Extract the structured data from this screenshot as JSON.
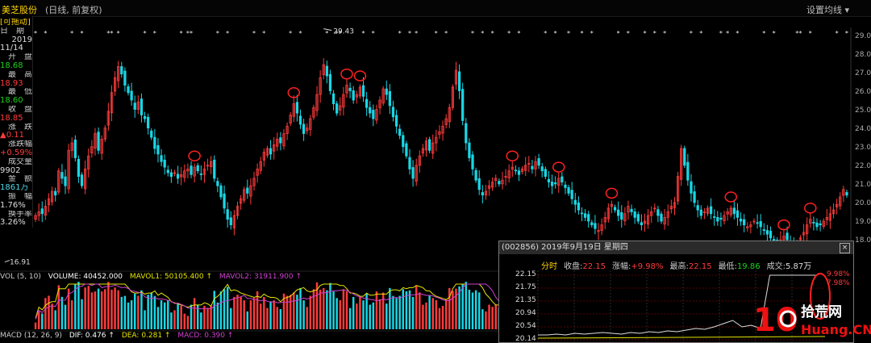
{
  "header": {
    "stock_name": "美芝股份",
    "mode": "(日线, 前复权)",
    "settings_label": "设置均线 ▾"
  },
  "info_panel": {
    "items": [
      {
        "text": "[可拖动]",
        "color": "#ffd400"
      },
      {
        "text": "日　期",
        "color": "#ccc"
      },
      {
        "text": "2019",
        "color": "#ddd"
      },
      {
        "text": "11/14",
        "color": "#ddd"
      },
      {
        "text": "开　盘",
        "color": "#ccc"
      },
      {
        "text": "18.68",
        "color": "#19d319"
      },
      {
        "text": "最　高",
        "color": "#ccc"
      },
      {
        "text": "18.93",
        "color": "#ff3b3b"
      },
      {
        "text": "最　低",
        "color": "#ccc"
      },
      {
        "text": "18.60",
        "color": "#19d319"
      },
      {
        "text": "收　盘",
        "color": "#ccc"
      },
      {
        "text": "18.85",
        "color": "#ff3b3b"
      },
      {
        "text": "涨　跌",
        "color": "#ccc"
      },
      {
        "text": "▲0.11",
        "color": "#ff3b3b"
      },
      {
        "text": "涨跌幅",
        "color": "#ccc"
      },
      {
        "text": "+0.59%",
        "color": "#ff3b3b"
      },
      {
        "text": "成交量",
        "color": "#ccc"
      },
      {
        "text": "9902",
        "color": "#ddd"
      },
      {
        "text": "金　额",
        "color": "#ccc"
      },
      {
        "text": "1861万",
        "color": "#4fd7e6"
      },
      {
        "text": "振　幅",
        "color": "#ccc"
      },
      {
        "text": "1.76%",
        "color": "#ddd"
      },
      {
        "text": "换手率",
        "color": "#ccc"
      },
      {
        "text": "3.26%",
        "color": "#ddd"
      }
    ]
  },
  "price_axis": {
    "ticks": [
      "29.00",
      "28.00",
      "27.00",
      "26.00",
      "25.00",
      "24.00",
      "23.00",
      "22.00",
      "21.00",
      "20.00",
      "19.00",
      "18.00"
    ]
  },
  "annotations": {
    "high_label": "29.43",
    "low_label": "16.91"
  },
  "volume_legend": {
    "name": "VOL (5, 10)",
    "volume": "VOLUME: 40452.000",
    "mavol1": "MAVOL1: 50105.400 ↑",
    "mavol2": "MAVOL2: 31911.900 ↑"
  },
  "macd_legend": {
    "name": "MACD (12, 26, 9)",
    "dif": "DIF: 0.476 ↑",
    "dea": "DEA: 0.281 ↑",
    "macd": "MACD: 0.390 ↑"
  },
  "popup": {
    "title": "(002856) 2019年9月19日 星期四",
    "close_label": "×",
    "info": [
      {
        "label": "分时",
        "value": ""
      },
      {
        "label": "收盘:",
        "value": "22.15"
      },
      {
        "label": "涨幅:",
        "value": "+9.98%"
      },
      {
        "label": "最高:",
        "value": "22.15"
      },
      {
        "label": "最低:",
        "value": "19.86"
      },
      {
        "label": "成交:",
        "value": "5.87万"
      }
    ],
    "left_ticks": [
      "22.15",
      "21.75",
      "21.35",
      "20.94",
      "20.54",
      "20.14"
    ],
    "right_ticks": [
      "9.98%",
      "7.98%"
    ]
  },
  "watermark": {
    "logo_number": "10",
    "text_top": "拾荒网",
    "text_bottom": "Huang.CN"
  },
  "colors": {
    "up": "#ff3b3b",
    "down": "#19d7e6",
    "ma_yellow": "#e5e500",
    "ma_magenta": "#d040d0",
    "accent": "#ffd400"
  },
  "chart_data": {
    "type": "candlestick",
    "ylim": [
      16.5,
      29.5
    ],
    "key_prices": {
      "high": 29.43,
      "low": 16.91
    },
    "closes": [
      19.4,
      19.6,
      19.5,
      19.9,
      20.3,
      20.7,
      20.5,
      21.8,
      21.4,
      21.0,
      22.9,
      23.3,
      22.5,
      21.5,
      21.0,
      21.9,
      22.6,
      23.1,
      23.8,
      22.9,
      23.5,
      24.1,
      25.0,
      26.0,
      26.8,
      27.4,
      27.0,
      26.4,
      26.0,
      25.6,
      25.1,
      25.5,
      24.8,
      24.6,
      24.1,
      23.6,
      23.0,
      22.7,
      22.3,
      22.0,
      21.7,
      21.5,
      21.7,
      21.4,
      21.6,
      21.8,
      21.9,
      21.6,
      22.0,
      21.8,
      21.6,
      21.9,
      22.1,
      22.3,
      21.4,
      21.0,
      20.4,
      19.8,
      19.2,
      18.9,
      19.4,
      19.9,
      20.3,
      20.8,
      20.6,
      21.0,
      21.4,
      21.9,
      22.3,
      22.8,
      23.0,
      22.7,
      23.2,
      23.5,
      23.3,
      23.8,
      24.2,
      24.8,
      25.4,
      24.9,
      24.3,
      23.8,
      24.1,
      24.6,
      25.2,
      25.9,
      26.8,
      27.5,
      26.9,
      26.1,
      25.4,
      24.9,
      25.3,
      25.9,
      26.4,
      26.1,
      25.6,
      25.9,
      26.3,
      25.8,
      25.2,
      24.9,
      24.6,
      25.1,
      25.6,
      26.2,
      25.9,
      25.3,
      24.7,
      24.2,
      23.7,
      23.1,
      22.6,
      21.9,
      21.4,
      22.1,
      22.6,
      23.0,
      23.4,
      22.9,
      23.3,
      23.6,
      23.9,
      24.2,
      24.6,
      25.2,
      26.3,
      27.2,
      26.1,
      24.5,
      23.3,
      22.5,
      21.9,
      21.3,
      20.8,
      20.5,
      20.7,
      21.0,
      21.2,
      21.4,
      21.1,
      21.3,
      21.5,
      21.8,
      22.0,
      21.8,
      21.6,
      21.9,
      22.1,
      22.2,
      21.9,
      22.3,
      22.1,
      21.8,
      21.5,
      21.2,
      21.0,
      21.1,
      21.4,
      21.2,
      20.9,
      20.6,
      20.3,
      20.0,
      19.7,
      19.5,
      19.3,
      19.1,
      18.9,
      18.7,
      18.6,
      18.9,
      19.3,
      19.8,
      20.0,
      19.7,
      19.4,
      19.2,
      19.5,
      19.9,
      19.6,
      19.3,
      19.1,
      18.9,
      19.1,
      19.4,
      19.6,
      19.8,
      19.4,
      19.1,
      19.3,
      19.6,
      19.9,
      20.1,
      21.5,
      23.0,
      22.1,
      21.3,
      20.6,
      20.1,
      19.7,
      19.4,
      19.6,
      19.8,
      19.5,
      19.3,
      19.1,
      19.2,
      19.4,
      19.6,
      19.8,
      19.5,
      19.3,
      19.1,
      18.9,
      18.8,
      18.9,
      19.1,
      19.0,
      18.8,
      18.6,
      18.4,
      18.2,
      18.0,
      17.9,
      18.1,
      18.3,
      18.1,
      17.9,
      17.8,
      17.9,
      18.2,
      18.5,
      18.9,
      19.2,
      19.0,
      18.8,
      18.9,
      19.1,
      19.3,
      19.5,
      19.7,
      20.0,
      20.4,
      20.8,
      20.5
    ]
  }
}
